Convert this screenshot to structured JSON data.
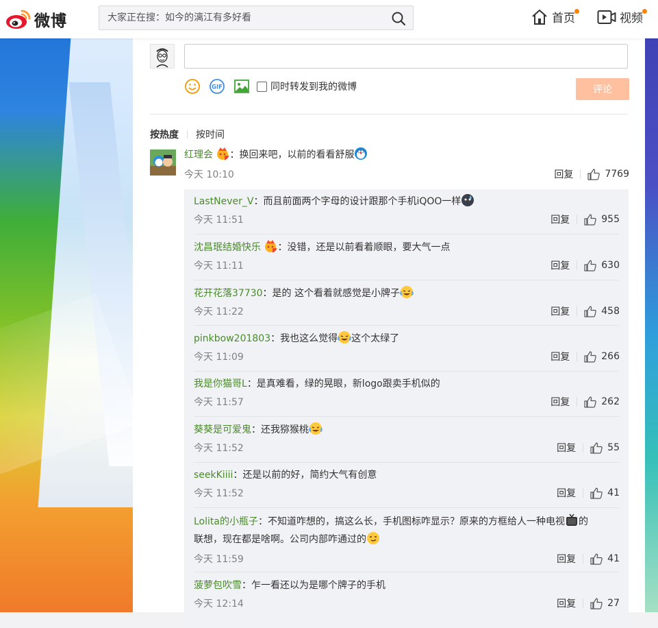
{
  "header": {
    "logo_text": "微博",
    "search_placeholder": "大家正在搜：如今的漓江有多好看",
    "nav": [
      {
        "label": "首页",
        "icon": "home-icon"
      },
      {
        "label": "视频",
        "icon": "video-icon"
      }
    ]
  },
  "composer": {
    "repost_label": "同时转发到我的微博",
    "submit_label": "评论",
    "tools": [
      "emoji-icon",
      "gif-icon",
      "image-icon"
    ]
  },
  "sort": {
    "hot": "按热度",
    "time": "按时间"
  },
  "main_comment": {
    "user": "红理会",
    "text": "：换回来吧，以前的看看舒服",
    "time": "今天 10:10",
    "reply_label": "回复",
    "likes": "7769"
  },
  "replies": [
    {
      "user": "LastNever_V",
      "text": "：而且前面两个字母的设计跟那个手机iQOO一样",
      "time": "今天 11:51",
      "likes": "955",
      "emoji": "sweat",
      "badge": false
    },
    {
      "user": "沈昌珉结婚快乐",
      "text": "：没错，还是以前看着顺眼，要大气一点",
      "time": "今天 11:11",
      "likes": "630",
      "emoji": "",
      "badge": true
    },
    {
      "user": "花开花落37730",
      "text": "：是的 这个看着就感觉是小牌子",
      "time": "今天 11:22",
      "likes": "458",
      "emoji": "laugh",
      "badge": false
    },
    {
      "user": "pinkbow201803",
      "text": "：我也这么觉得",
      "text2": "这个太绿了",
      "time": "今天 11:09",
      "likes": "266",
      "emoji": "laugh",
      "badge": false
    },
    {
      "user": "我是你猫哥L",
      "text": "：是真难看，绿的晃眼，新logo跟卖手机似的",
      "time": "今天 11:57",
      "likes": "262",
      "emoji": "",
      "badge": false
    },
    {
      "user": "葵葵是可爱鬼",
      "text": "：还我猕猴桃",
      "time": "今天 11:52",
      "likes": "55",
      "emoji": "laugh",
      "badge": false
    },
    {
      "user": "seekKiiii",
      "text": "：还是以前的好，简约大气有创意",
      "time": "今天 11:52",
      "likes": "41",
      "emoji": "",
      "badge": false
    },
    {
      "user": "Lolita的小瓶子",
      "text": "：不知道咋想的，搞这么长，手机图标咋显示？原来的方框给人一种电视",
      "text2": "的",
      "line2": "联想，现在都是啥啊。公司内部咋通过的",
      "time": "今天 11:59",
      "likes": "41",
      "emoji": "tv",
      "badge": false
    },
    {
      "user": "菠萝包吹雪",
      "text": "：乍一看还以为是哪个牌子的手机",
      "time": "今天 12:14",
      "likes": "27",
      "emoji": "",
      "badge": false
    }
  ],
  "colors": {
    "accent": "#ff8200",
    "username": "#4a8a2c",
    "submit": "#ffc09f"
  }
}
